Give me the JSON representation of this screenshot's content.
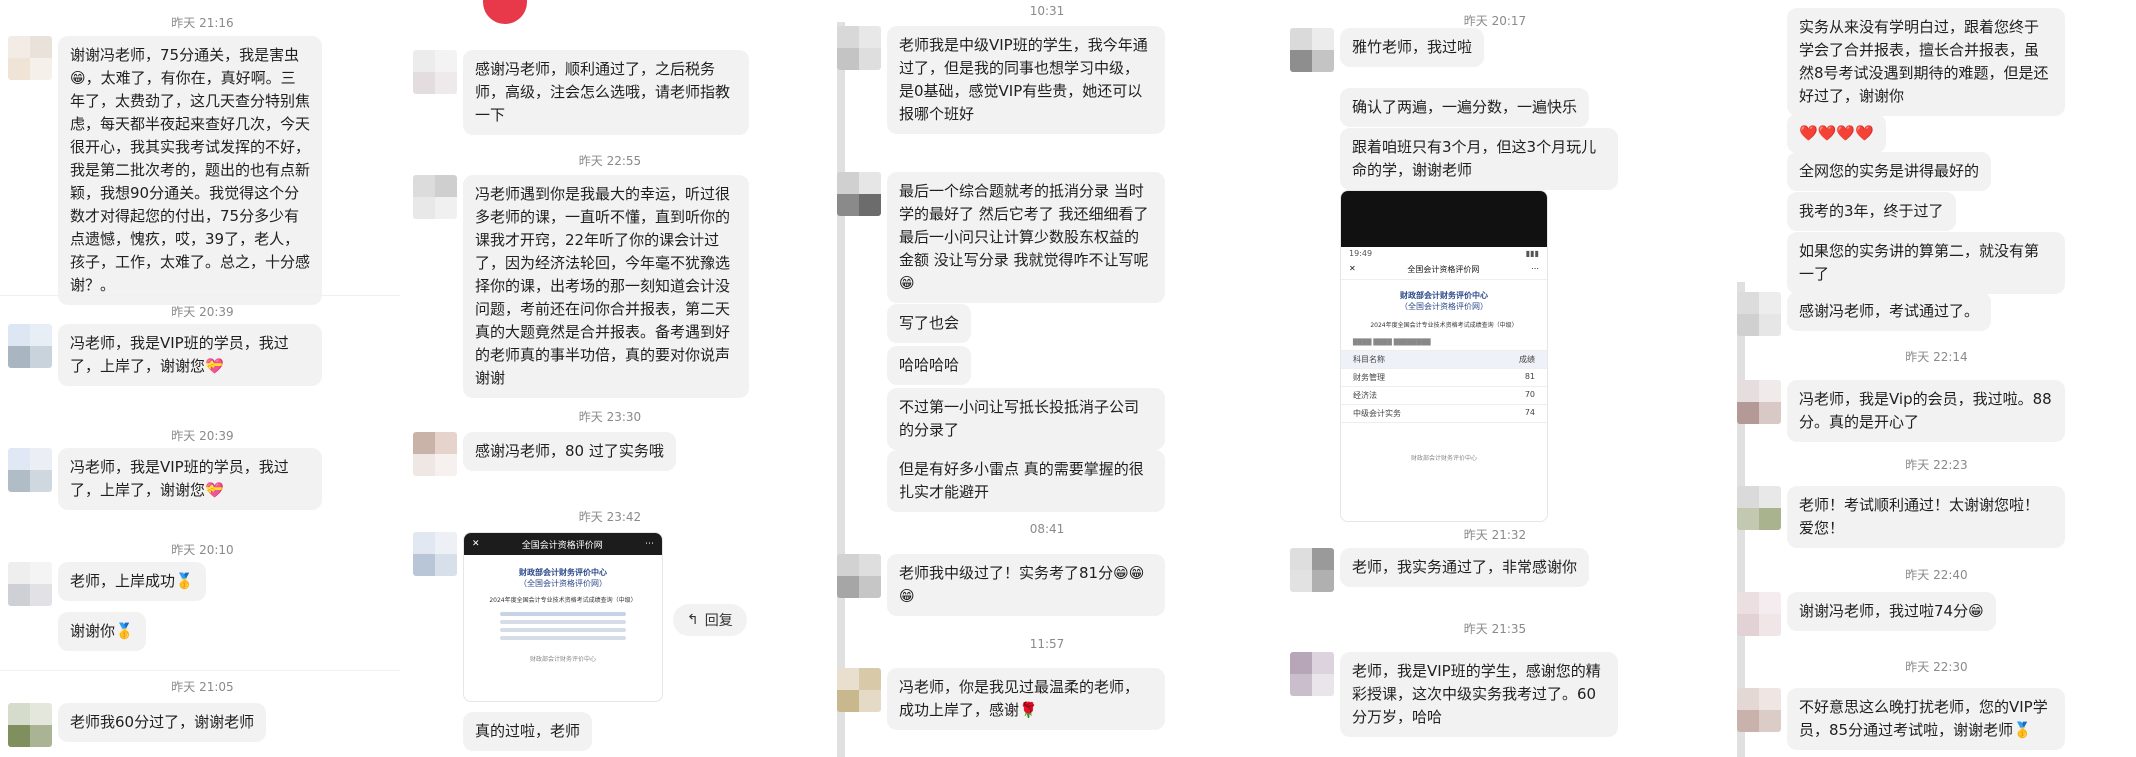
{
  "panel1": {
    "ts1": "昨天 21:16",
    "msg1": "谢谢冯老师，75分通关，我是害虫😁，太难了，有你在，真好啊。三年了，太费劲了，这几天查分特别焦虑，每天都半夜起来查好几次，今天很开心，我其实我考试发挥的不好，我是第二批次考的，题出的也有点新颖，我想90分通关。我觉得这个分数才对得起您的付出，75分多少有点遗憾，愧疚，哎，39了，老人，孩子，工作，太难了。总之，十分感谢？。",
    "ts2": "昨天 20:39",
    "msg2": "冯老师，我是VIP班的学员，我过了，上岸了，谢谢您💝",
    "ts3": "昨天 20:39",
    "msg3": "冯老师，我是VIP班的学员，我过了，上岸了，谢谢您💝",
    "ts4": "昨天 20:10",
    "msg4": "老师，上岸成功🥇",
    "msg5": "谢谢你🥇",
    "ts5": "昨天 21:05",
    "msg6": "老师我60分过了，谢谢老师"
  },
  "panel2": {
    "msg1": "感谢冯老师，顺利通过了，之后税务师，高级，注会怎么选哦，请老师指教一下",
    "ts1": "昨天 22:55",
    "msg2": "冯老师遇到你是我最大的幸运，听过很多老师的课，一直听不懂，直到听你的课我才开窍，22年听了你的课会计过了，因为经济法轮回，今年毫不犹豫选择你的课，出考场的那一刻知道会计没问题，考前还在问你合并报表，第二天真的大题竟然是合并报表。备考遇到好的老师真的事半功倍，真的要对你说声谢谢",
    "ts2": "昨天 23:30",
    "msg3": "感谢冯老师，80 过了实务哦",
    "ts3": "昨天 23:42",
    "card_header": "全国会计资格评价网",
    "card_org1": "财政部会计财务评价中心",
    "card_org2": "（全国会计资格评价网）",
    "card_title": "2024年度全国会计专业技术资格考试成绩查询（中级）",
    "reply": "回复",
    "msg4": "真的过啦，老师"
  },
  "panel3": {
    "ts1": "10:31",
    "msg1": "老师我是中级VIP班的学生，我今年通过了，但是我的同事也想学习中级，是0基础，感觉VIP有些贵，她还可以报哪个班好",
    "msg2": "最后一个综合题就考的抵消分录 当时学的最好了 然后它考了 我还细细看了最后一小问只让计算少数股东权益的金额 没让写分录 我就觉得咋不让写呢😁",
    "msg3": "写了也会",
    "msg4": "哈哈哈哈",
    "msg5": "不过第一小问让写抵长投抵消子公司的分录了",
    "msg6": "但是有好多小雷点 真的需要掌握的很扎实才能避开",
    "ts2": "08:41",
    "msg7": "老师我中级过了！实务考了81分😁😁😁",
    "ts3": "11:57",
    "msg8": "冯老师，你是我见过最温柔的老师，成功上岸了，感谢🌹"
  },
  "panel4": {
    "ts1": "昨天 20:17",
    "msg1": "雅竹老师，我过啦",
    "msg2": "确认了两遍，一遍分数，一遍快乐",
    "msg3": "跟着咱班只有3个月，但这3个月玩儿命的学，谢谢老师",
    "shot_time": "19:49",
    "shot_header": "全国会计资格评价网",
    "shot_org1": "财政部会计财务评价中心",
    "shot_org2": "（全国会计资格评价网）",
    "shot_title": "2024年度全国会计专业技术资格考试成绩查询（中级）",
    "shot_rows": [
      {
        "subject": "科目名称",
        "score": "成绩"
      },
      {
        "subject": "财务管理",
        "score": "81"
      },
      {
        "subject": "经济法",
        "score": "70"
      },
      {
        "subject": "中级会计实务",
        "score": "74"
      }
    ],
    "ts2": "昨天 21:32",
    "msg4": "老师，我实务通过了，非常感谢你",
    "ts3": "昨天 21:35",
    "msg5": "老师，我是VIP班的学生，感谢您的精彩授课，这次中级实务我考过了。60分万岁，哈哈"
  },
  "panel5": {
    "msg1": "实务从来没有学明白过，跟着您终于学会了合并报表，擅长合并报表，虽然8号考试没遇到期待的难题，但是还好过了，谢谢你",
    "msg2": "❤️❤️❤️❤️",
    "msg3": "全网您的实务是讲得最好的",
    "msg4": "我考的3年，终于过了",
    "msg5": "如果您的实务讲的算第二，就没有第一了",
    "msg6": "感谢冯老师，考试通过了。",
    "ts1": "昨天 22:14",
    "msg7": "冯老师，我是Vip的会员，我过啦。88分。真的是开心了",
    "ts2": "昨天 22:23",
    "msg8": "老师！考试顺利通过！太谢谢您啦！爱您！",
    "ts3": "昨天 22:40",
    "msg9": "谢谢冯老师，我过啦74分😁",
    "ts4": "昨天 22:30",
    "msg10": "不好意思这么晚打扰老师，您的VIP学员，85分通过考试啦，谢谢老师🥇"
  }
}
